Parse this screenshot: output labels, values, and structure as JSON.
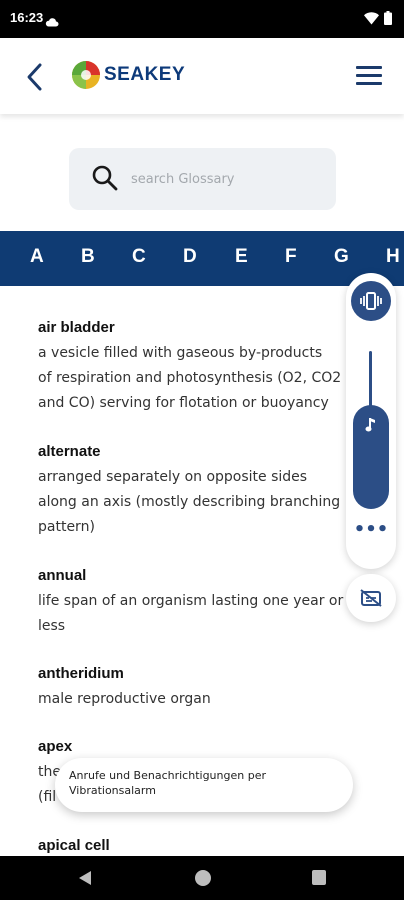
{
  "status_bar": {
    "time": "16:23"
  },
  "header": {
    "app_name": "SEAKEY"
  },
  "search": {
    "placeholder": "search Glossary",
    "value": ""
  },
  "alphabet": [
    "A",
    "B",
    "C",
    "D",
    "E",
    "F",
    "G",
    "H"
  ],
  "entries": [
    {
      "term": "air bladder",
      "lines": [
        "a vesicle filled with gaseous by-products",
        "of respiration and photosynthesis (O2, CO2",
        "and CO) serving for flotation or buoyancy"
      ]
    },
    {
      "term": "alternate",
      "lines": [
        "arranged separately on opposite sides",
        "along an axis (mostly describing branching",
        "pattern)"
      ]
    },
    {
      "term": "annual",
      "lines": [
        "life span of an organism lasting one year or",
        "less"
      ]
    },
    {
      "term": "antheridium",
      "lines": [
        "male reproductive organ"
      ]
    },
    {
      "term": "apex",
      "lines": [
        "the",
        "(fil"
      ]
    },
    {
      "term": "apical cell",
      "lines": []
    }
  ],
  "volume_panel": {
    "more_label": "•••",
    "level_percent": 60
  },
  "toast": {
    "text": "Anrufe und Benachrichtigungen per Vibrationsalarm"
  },
  "colors": {
    "brand_navy": "#0f3b73",
    "accent": "#2c4e86",
    "search_bg": "#eef1f4"
  },
  "icons": {
    "back": "chevron-left-icon",
    "menu": "hamburger-icon",
    "search": "search-icon",
    "vibrate": "vibrate-icon",
    "music": "music-note-icon",
    "captions": "captions-off-icon"
  }
}
